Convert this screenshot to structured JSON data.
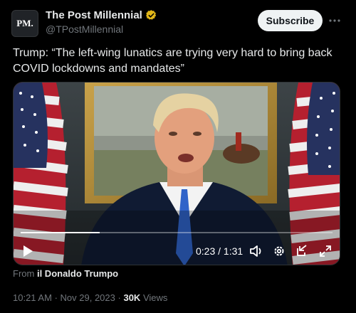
{
  "account": {
    "avatar_text": "PM.",
    "display_name": "The Post Millennial",
    "handle": "@TPostMillennial",
    "verified_badge": "gold-verified-icon"
  },
  "subscribe_label": "Subscribe",
  "tweet_text": "Trump: “The left-wing lunatics are trying very hard to bring back COVID lockdowns and mandates”",
  "video": {
    "current_time": "0:23",
    "separator": "/",
    "duration": "1:31",
    "progress": 0.253,
    "controls": [
      "play-icon",
      "volume-icon",
      "settings-icon",
      "popout-icon",
      "fullscreen-icon"
    ]
  },
  "from_line": {
    "prefix": "From",
    "source": "il Donaldo Trumpo"
  },
  "meta": {
    "time": "10:21 AM",
    "dot": "·",
    "date": "Nov 29, 2023",
    "views_count": "30K",
    "views_label": "Views"
  },
  "colors": {
    "background": "#000000",
    "verified_gold": "#e2b719",
    "subscribe_bg": "#eff3f4",
    "muted": "#71767b"
  }
}
